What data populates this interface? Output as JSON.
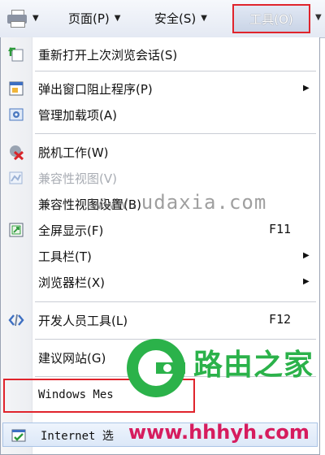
{
  "toolbar": {
    "page_label": "页面(P)",
    "safety_label": "安全(S)",
    "tools_label": "工具(O)"
  },
  "menu": {
    "items": [
      {
        "label": "重新打开上次浏览会话(S)"
      },
      {
        "label": "弹出窗口阻止程序(P)"
      },
      {
        "label": "管理加载项(A)"
      },
      {
        "label": "脱机工作(W)"
      },
      {
        "label": "兼容性视图(V)"
      },
      {
        "label": "兼容性视图设置(B)"
      },
      {
        "label": "全屏显示(F)",
        "shortcut": "F11"
      },
      {
        "label": "工具栏(T)"
      },
      {
        "label": "浏览器栏(X)"
      },
      {
        "label": "开发人员工具(L)",
        "shortcut": "F12"
      },
      {
        "label": "建议网站(G)"
      },
      {
        "label": "Windows Mes"
      },
      {
        "label": "Internet 选"
      }
    ]
  },
  "watermark": {
    "url": "www.udaxia.com",
    "logo_text": "路由之家",
    "logo_url": "www.hhhyh.com"
  },
  "colors": {
    "highlight": "#e0242c",
    "logo_green": "#2bb24a",
    "logo_pink": "#d61c5e"
  }
}
